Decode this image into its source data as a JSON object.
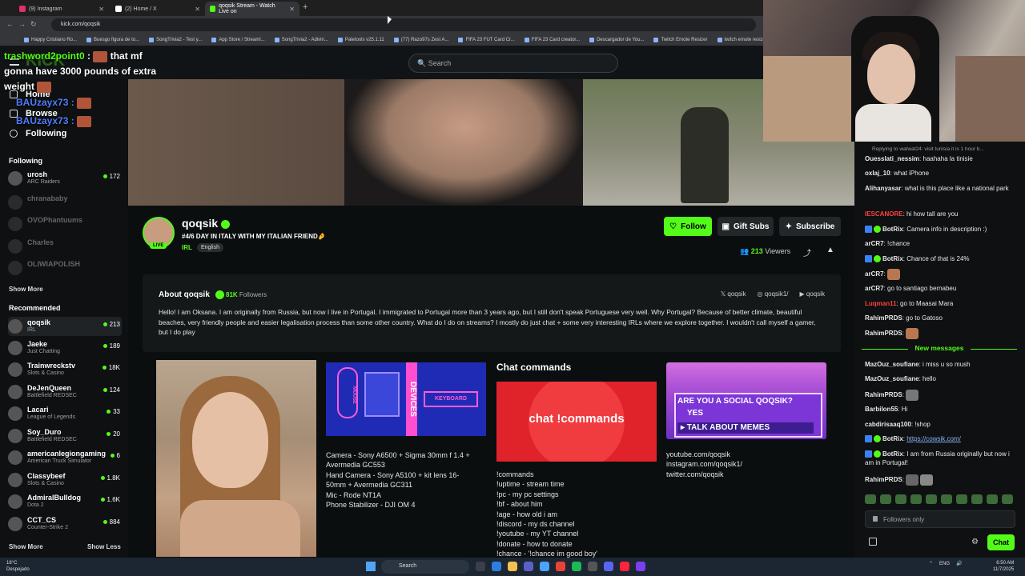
{
  "browser": {
    "tabs": [
      {
        "label": "(9) Instagram",
        "color": "#e1306c"
      },
      {
        "label": "(2) Home / X",
        "color": "#ffffff"
      },
      {
        "label": "qoqsik Stream - Watch Live on",
        "color": "#53fc18"
      }
    ],
    "url": "kick.com/qoqsik",
    "bookmarks": [
      "Happy Cristiano Ro...",
      "Buesgo figura de to...",
      "SongTrivia2 - Test y...",
      "App Store / Streami...",
      "SongTrivia2 - Adivin...",
      "Paletools v25.1.11",
      "(77) Razo97s Zest A...",
      "FIFA 23 FUT Card Cr...",
      "FIFA 23 Card creator...",
      "Descargador de You...",
      "Twitch Emote Resizer",
      "twitch emote resizer..."
    ]
  },
  "header": {
    "search_placeholder": "Search",
    "logo": "KICK"
  },
  "overlay": {
    "line1_user": "trashword2point0",
    "line1_text": "that mf gonna have 3000 pounds of extra weight",
    "line2_user": "BAUzayx73 :",
    "line3_user": "BAUzayx73 :"
  },
  "sidebar": {
    "nav": [
      {
        "label": "Home"
      },
      {
        "label": "Browse"
      },
      {
        "label": "Following"
      }
    ],
    "following_title": "Following",
    "following": [
      {
        "name": "urosh",
        "sub": "ARC Raiders",
        "viewers": "172",
        "live": true
      },
      {
        "name": "chranababy",
        "sub": "",
        "viewers": "",
        "live": false
      },
      {
        "name": "OVOPhantuums",
        "sub": "",
        "viewers": "",
        "live": false
      },
      {
        "name": "Charles",
        "sub": "",
        "viewers": "",
        "live": false
      },
      {
        "name": "OLIWIAPOLISH",
        "sub": "",
        "viewers": "",
        "live": false
      }
    ],
    "show_more": "Show More",
    "recommended_title": "Recommended",
    "recommended": [
      {
        "name": "qoqsik",
        "sub": "IRL",
        "viewers": "213"
      },
      {
        "name": "Jaeke",
        "sub": "Just Chatting",
        "viewers": "189"
      },
      {
        "name": "Trainwreckstv",
        "sub": "Slots & Casino",
        "viewers": "18K"
      },
      {
        "name": "DeJenQueen",
        "sub": "Battlefield REDSEC",
        "viewers": "124"
      },
      {
        "name": "Lacari",
        "sub": "League of Legends",
        "viewers": "33"
      },
      {
        "name": "Soy_Duro",
        "sub": "Battlefield REDSEC",
        "viewers": "20"
      },
      {
        "name": "americanlegiongaming",
        "sub": "American Truck Simulator",
        "viewers": "6"
      },
      {
        "name": "Classybeef",
        "sub": "Slots & Casino",
        "viewers": "1.8K"
      },
      {
        "name": "AdmiralBulldog",
        "sub": "Dota 2",
        "viewers": "1.6K"
      },
      {
        "name": "CCT_CS",
        "sub": "Counter-Strike 2",
        "viewers": "884"
      }
    ],
    "show_more_2": "Show More",
    "show_less": "Show Less"
  },
  "channel": {
    "name": "qoqsik",
    "live": "LIVE",
    "title": "#4/6 DAY IN ITALY WITH MY ITALIAN FRIEND🤌",
    "category": "IRL",
    "language": "English",
    "follow": "Follow",
    "gift_subs": "Gift Subs",
    "subscribe": "Subscribe",
    "viewers": "213",
    "viewers_label": "Viewers"
  },
  "about": {
    "title": "About qoqsik",
    "followers": "81K",
    "followers_label": "Followers",
    "socials": [
      "qoqsik",
      "qoqsik1/",
      "qoqsik"
    ],
    "bio": "Hello! I am Oksana. I am originally from Russia, but now I live in Portugal. I immigrated to Portugal more than 3 years ago, but I still don't speak Portuguese very well. Why Portugal? Because of better climate, beautiful beaches, very friendly people and easier legalisation process than some other country. What do I do on streams? I mostly do just chat + some very interesting IRLs where we explore together. I wouldn't call myself a gamer, but I do play"
  },
  "panels": {
    "devices_img": {
      "mouse": "MOUSE",
      "devices": "DEVICES",
      "keyboard": "KEYBOARD"
    },
    "devices_text": "Camera - Sony A6500 + Sigma 30mm f 1.4 +\nAvermedia GC553\nHand Camera - Sony A5100 + kit lens 16-\n50mm + Avermedia GC311\nMic - Rode NT1A\nPhone Stabilizer - DJI OM 4",
    "commands_title": "Chat commands",
    "commands_img": "chat !commands",
    "commands_text": "!commands\n!uptime - stream time\n!pc - my pc settings\n!bf - about him\n!age - how old i am\n!discord - my ds channel\n!youtube - my YT channel\n!donate - how to donate\n!chance - '!chance im good boy'",
    "social_q": "ARE YOU A SOCIAL QOQSIK?",
    "social_yes": "YES",
    "social_talk": "▸ TALK ABOUT MEMES",
    "social_text": "youtube.com/qoqsik\ninstagram.com/qoqsik1/\ntwitter.com/qoqsik"
  },
  "chat": {
    "reply": "Replying to watwat24: visit tunisia it is 1 hour b...",
    "messages": [
      {
        "user": "Ouesslati_nessim",
        "color": "#e8e8e8",
        "text": "haahaha la tinisie",
        "bot": false
      },
      {
        "user": "oxlaj_10",
        "color": "#e8e8e8",
        "text": "what iPhone",
        "bot": false
      },
      {
        "user": "Alihanyasar",
        "color": "#e8e8e8",
        "text": "what is this place like a national park",
        "bot": false
      },
      {
        "user": "IESCANORE",
        "color": "#ff4040",
        "text": "hi how tall are you",
        "bot": false
      },
      {
        "user": "BotRix",
        "color": "#e8e8e8",
        "text": "Camera info in description :)",
        "bot": true
      },
      {
        "user": "arCR7",
        "color": "#e8e8e8",
        "text": "!chance",
        "bot": false
      },
      {
        "user": "BotRix",
        "color": "#e8e8e8",
        "text": "Chance of that is 24%",
        "bot": true
      },
      {
        "user": "arCR7",
        "color": "#e8e8e8",
        "text": "",
        "bot": false,
        "emote": true
      },
      {
        "user": "arCR7",
        "color": "#e8e8e8",
        "text": "go to santiago bernabeu",
        "bot": false
      },
      {
        "user": "Luqman11",
        "color": "#ff4040",
        "text": "go to Maasai Mara",
        "bot": false
      },
      {
        "user": "RahimPRDS",
        "color": "#e8e8e8",
        "text": "go to Gatoso",
        "bot": false
      },
      {
        "user": "RahimPRDS",
        "color": "#e8e8e8",
        "text": "",
        "bot": false,
        "emote": true
      }
    ],
    "new_messages": "New messages",
    "messages2": [
      {
        "user": "MazOuz_soufiane",
        "text": "i miss u so mush"
      },
      {
        "user": "MazOuz_soufiane",
        "text": "hello"
      },
      {
        "user": "RahimPRDS",
        "text": ""
      },
      {
        "user": "Barbilon55",
        "text": "Hi"
      },
      {
        "user": "cabdirisaaq100",
        "text": "!shop"
      },
      {
        "user": "BotRix",
        "text": "",
        "link": "https://cowsik.com/"
      },
      {
        "user": "BotRix",
        "text": "I am from Russia originally but now i am in Portugal!"
      },
      {
        "user": "RahimPRDS",
        "text": ""
      }
    ],
    "input_placeholder": "Followers only",
    "send": "Chat"
  },
  "taskbar": {
    "weather_temp": "18°C",
    "weather_desc": "Despejado",
    "search": "Search",
    "lang": "ENG",
    "time": "6:50 AM",
    "date": "11/7/2025"
  }
}
